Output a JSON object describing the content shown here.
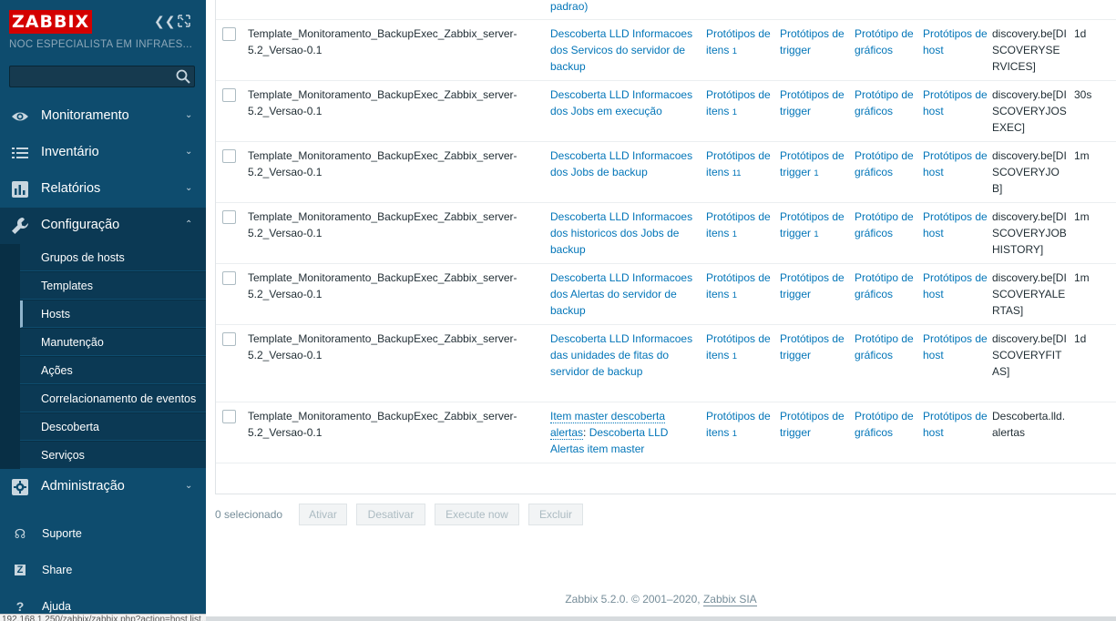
{
  "brand": {
    "logo": "ZABBIX",
    "server_name": "NOC ESPECIALISTA EM INFRAES..."
  },
  "search": {
    "value": "",
    "placeholder": ""
  },
  "menu": {
    "monitoramento": "Monitoramento",
    "inventario": "Inventário",
    "relatorios": "Relatórios",
    "configuracao": "Configuração",
    "administracao": "Administração"
  },
  "submenu": [
    "Grupos de hosts",
    "Templates",
    "Hosts",
    "Manutenção",
    "Ações",
    "Correlacionamento de eventos",
    "Descoberta",
    "Serviços"
  ],
  "aux": {
    "suporte": "Suporte",
    "share": "Share",
    "ajuda": "Ajuda"
  },
  "status_url": "192.168.1.250/zabbix/zabbix.php?action=host.list...",
  "top_partial": "padrao)",
  "rows": [
    {
      "template": "Template_Monitoramento_BackupExec_Zabbix_server-5.2_Versao-0.1",
      "name": "Descoberta LLD Informacoes dos Servicos do servidor de backup",
      "items": "Protótipos de itens",
      "items_count": "1",
      "triggers": "Protótipos de trigger",
      "triggers_count": "",
      "graphs": "Protótipo de gráficos",
      "hosts": "Protótipos de host",
      "key": "discovery.be[DISCOVERYSERVICES]",
      "interval": "1d"
    },
    {
      "template": "Template_Monitoramento_BackupExec_Zabbix_server-5.2_Versao-0.1",
      "name": "Descoberta LLD Informacoes dos Jobs em execução",
      "items": "Protótipos de itens",
      "items_count": "1",
      "triggers": "Protótipos de trigger",
      "triggers_count": "",
      "graphs": "Protótipo de gráficos",
      "hosts": "Protótipos de host",
      "key": "discovery.be[DISCOVERYJOSEXEC]",
      "interval": "30s"
    },
    {
      "template": "Template_Monitoramento_BackupExec_Zabbix_server-5.2_Versao-0.1",
      "name": "Descoberta LLD Informacoes dos Jobs de backup",
      "items": "Protótipos de itens",
      "items_count": "11",
      "triggers": "Protótipos de trigger",
      "triggers_count": "1",
      "graphs": "Protótipo de gráficos",
      "hosts": "Protótipos de host",
      "key": "discovery.be[DISCOVERYJOB]",
      "interval": "1m"
    },
    {
      "template": "Template_Monitoramento_BackupExec_Zabbix_server-5.2_Versao-0.1",
      "name": "Descoberta LLD Informacoes dos historicos dos Jobs de backup",
      "items": "Protótipos de itens",
      "items_count": "1",
      "triggers": "Protótipos de trigger",
      "triggers_count": "1",
      "graphs": "Protótipo de gráficos",
      "hosts": "Protótipos de host",
      "key": "discovery.be[DISCOVERYJOBHISTORY]",
      "interval": "1m"
    },
    {
      "template": "Template_Monitoramento_BackupExec_Zabbix_server-5.2_Versao-0.1",
      "name": "Descoberta LLD Informacoes dos Alertas do servidor de backup",
      "items": "Protótipos de itens",
      "items_count": "1",
      "triggers": "Protótipos de trigger",
      "triggers_count": "",
      "graphs": "Protótipo de gráficos",
      "hosts": "Protótipos de host",
      "key": "discovery.be[DISCOVERYALERTAS]",
      "interval": "1m"
    },
    {
      "template": "Template_Monitoramento_BackupExec_Zabbix_server-5.2_Versao-0.1",
      "name": "Descoberta LLD Informacoes das unidades de fitas do servidor de backup",
      "items": "Protótipos de itens",
      "items_count": "1",
      "triggers": "Protótipos de trigger",
      "triggers_count": "",
      "graphs": "Protótipo de gráficos",
      "hosts": "Protótipos de host",
      "key": "discovery.be[DISCOVERYFITAS]",
      "interval": "1d"
    },
    {
      "template": "Template_Monitoramento_BackupExec_Zabbix_server-5.2_Versao-0.1",
      "master": "Item master descoberta alertas",
      "name": "Descoberta LLD Alertas item master",
      "items": "Protótipos de itens",
      "items_count": "1",
      "triggers": "Protótipos de trigger",
      "triggers_count": "",
      "graphs": "Protótipo de gráficos",
      "hosts": "Protótipos de host",
      "key": "Descoberta.lld.alertas",
      "interval": ""
    }
  ],
  "actions": {
    "selected": "0 selecionado",
    "enable": "Ativar",
    "disable": "Desativar",
    "execute": "Execute now",
    "delete": "Excluir"
  },
  "footer": {
    "text": "Zabbix 5.2.0. © 2001–2020,",
    "link": "Zabbix SIA"
  }
}
